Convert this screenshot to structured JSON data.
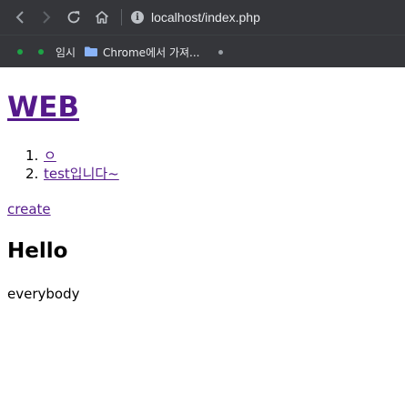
{
  "browser": {
    "url": "localhost/index.php",
    "icons": {
      "back": "arrow-left-icon",
      "forward": "arrow-right-icon",
      "reload": "reload-icon",
      "home": "home-icon",
      "site_info": "info-icon"
    },
    "bookmarks": {
      "temp_label": "임시",
      "folder_label": "Chrome에서 가져...",
      "folder_icon": "folder-icon"
    },
    "colors": {
      "chrome_bg": "#35363a",
      "url_text": "#e8eaed",
      "bookmark_dot": "#1ea446"
    }
  },
  "page": {
    "title": "WEB",
    "topics": [
      {
        "num": "1.",
        "label": "ㅇ"
      },
      {
        "num": "2.",
        "label": "test입니다~"
      }
    ],
    "create_label": "create",
    "heading": "Hello",
    "body": "everybody",
    "colors": {
      "visited_link": "#551a8b",
      "text": "#000000"
    }
  }
}
